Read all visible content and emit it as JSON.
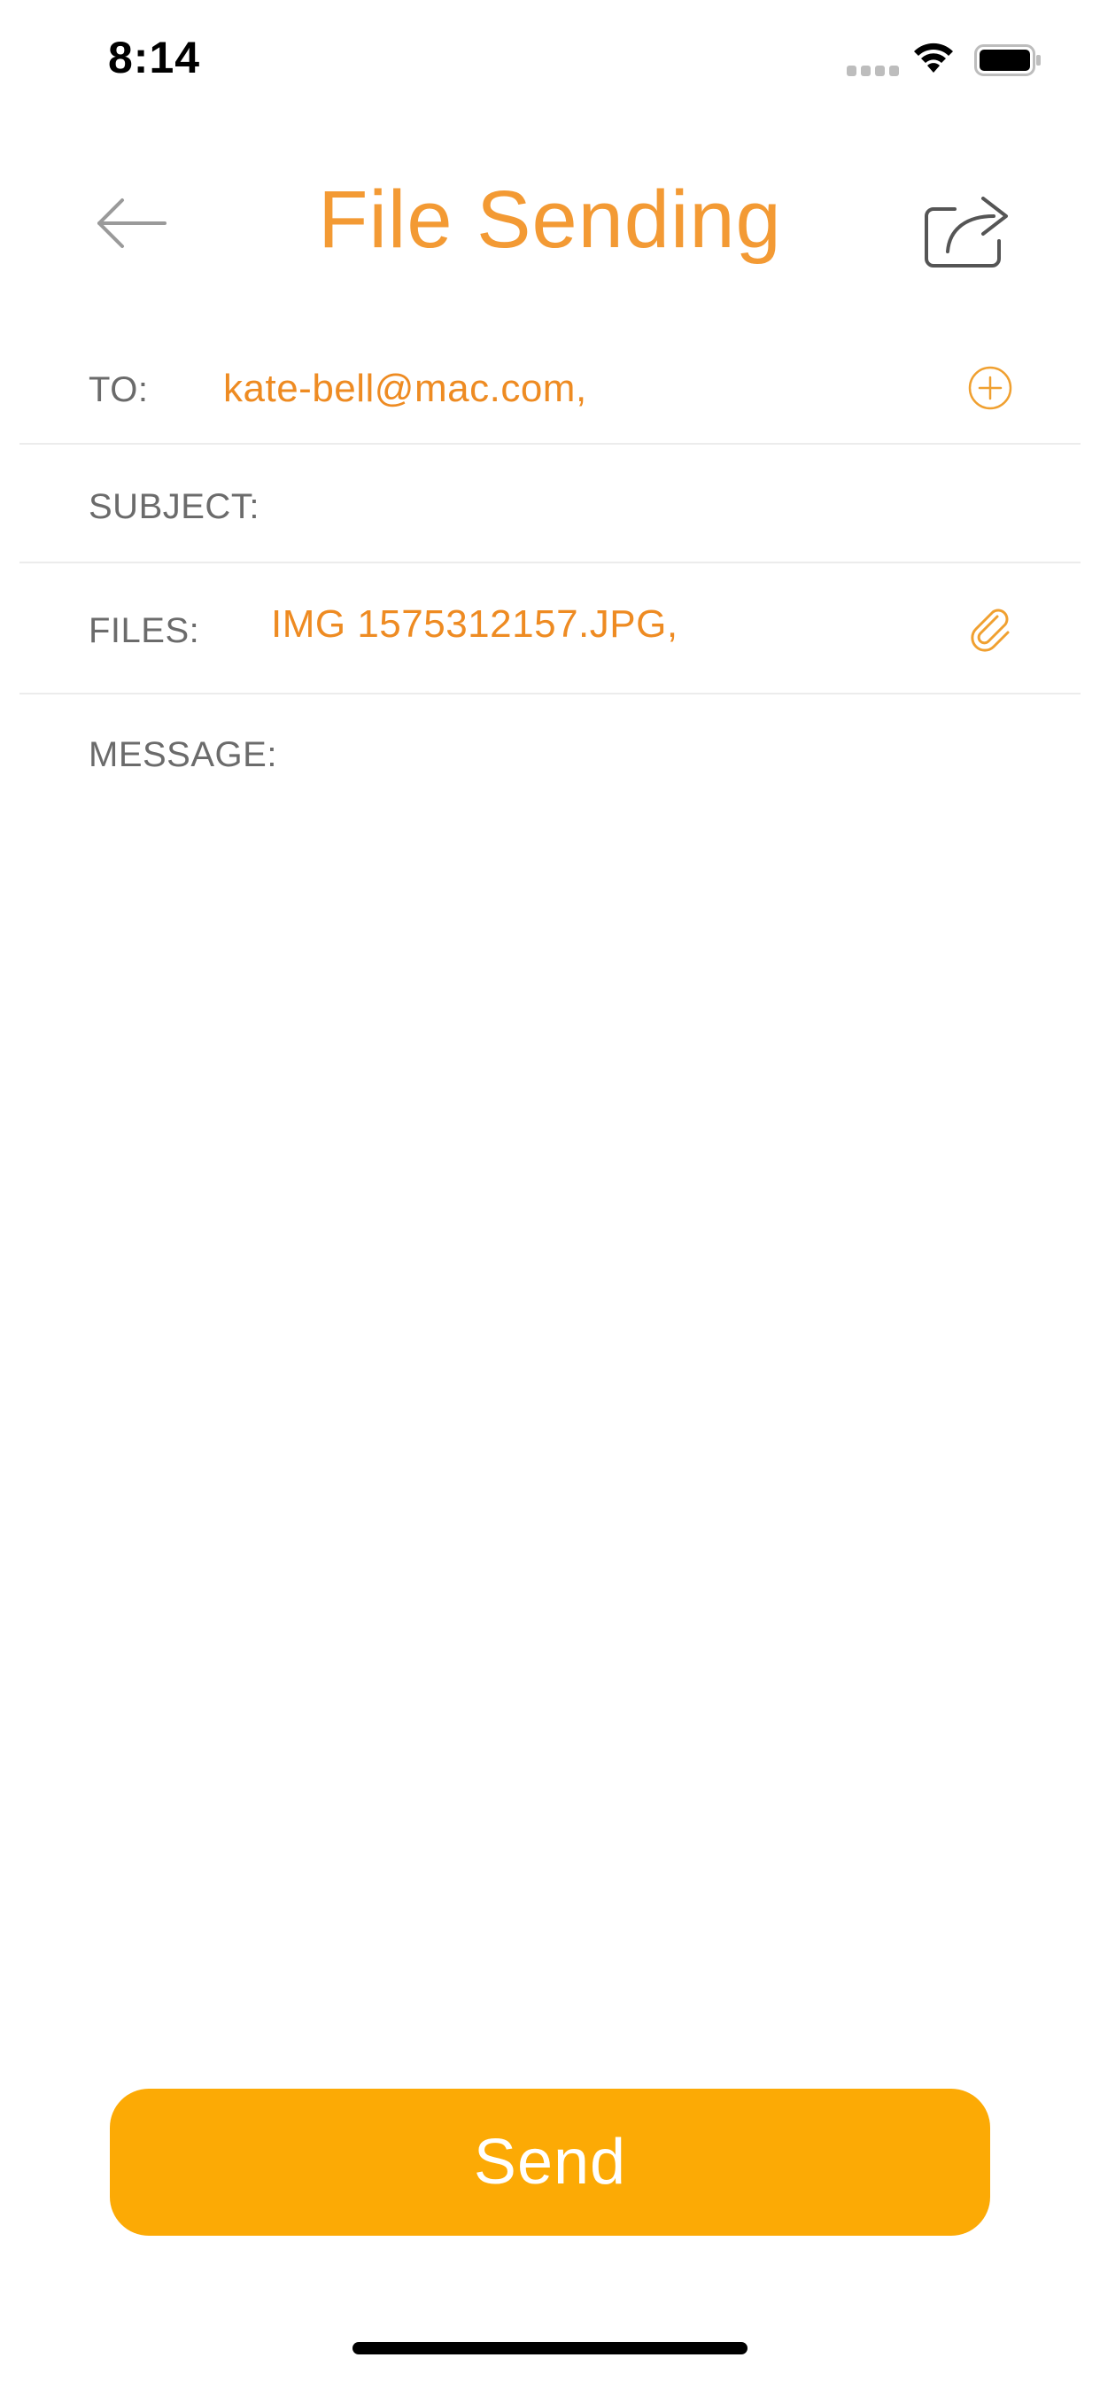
{
  "status_bar": {
    "time": "8:14"
  },
  "nav": {
    "title": "File Sending",
    "back_icon": "arrow-left-icon",
    "share_icon": "share-icon"
  },
  "form": {
    "to": {
      "label": "TO:",
      "value": "kate-bell@mac.com,",
      "action_icon": "plus-circle-icon"
    },
    "subject": {
      "label": "SUBJECT:",
      "value": ""
    },
    "files": {
      "label": "FILES:",
      "value": "IMG 1575312157.JPG,",
      "action_icon": "paperclip-icon"
    },
    "message": {
      "label": "MESSAGE:",
      "value": ""
    }
  },
  "send_button": {
    "label": "Send"
  },
  "colors": {
    "accent": "#F39A34",
    "value_text": "#EE8B22",
    "send_button": "#FCAA05",
    "label_text": "#6b6b6b",
    "divider": "#ececec"
  }
}
